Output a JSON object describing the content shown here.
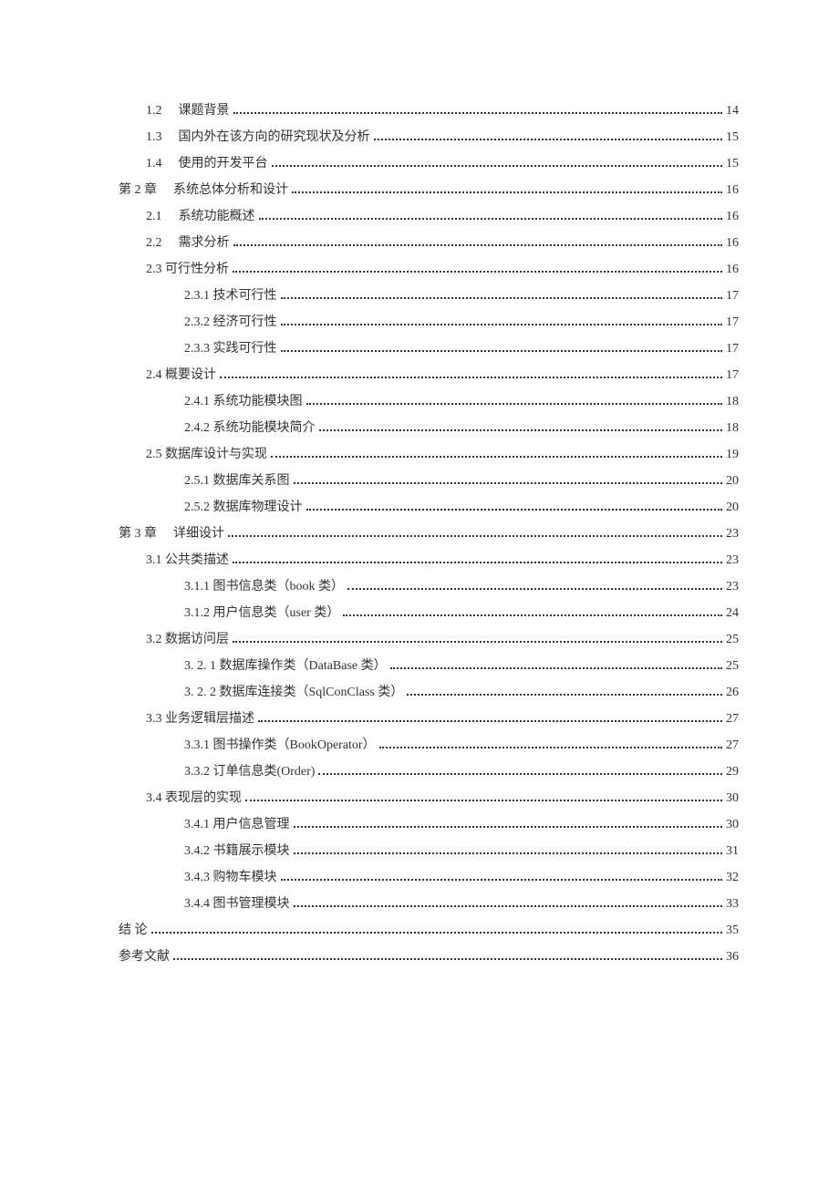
{
  "toc": [
    {
      "indent": "indent-num",
      "num": "1.2",
      "title": "课题背景",
      "page": "14"
    },
    {
      "indent": "indent-num",
      "num": "1.3",
      "title": "国内外在该方向的研究现状及分析",
      "page": "15"
    },
    {
      "indent": "indent-num",
      "num": "1.4",
      "title": "使用的开发平台",
      "page": "15"
    },
    {
      "indent": "indent-0",
      "num": "第 2 章",
      "title": "系统总体分析和设计",
      "page": "16"
    },
    {
      "indent": "indent-num",
      "num": "2.1",
      "title": "系统功能概述",
      "page": "16"
    },
    {
      "indent": "indent-num",
      "num": "2.2",
      "title": "需求分析",
      "page": "16"
    },
    {
      "indent": "indent-1",
      "num": "",
      "title": "2.3 可行性分析",
      "page": "16"
    },
    {
      "indent": "indent-2",
      "num": "",
      "title": "2.3.1 技术可行性",
      "page": "17"
    },
    {
      "indent": "indent-2",
      "num": "",
      "title": "2.3.2 经济可行性",
      "page": "17"
    },
    {
      "indent": "indent-2",
      "num": "",
      "title": "2.3.3 实践可行性",
      "page": "17"
    },
    {
      "indent": "indent-1",
      "num": "",
      "title": "2.4 概要设计",
      "page": "17"
    },
    {
      "indent": "indent-2",
      "num": "",
      "title": "2.4.1 系统功能模块图",
      "page": "18"
    },
    {
      "indent": "indent-2",
      "num": "",
      "title": "2.4.2 系统功能模块简介",
      "page": "18"
    },
    {
      "indent": "indent-1",
      "num": "",
      "title": "2.5 数据库设计与实现",
      "page": "19"
    },
    {
      "indent": "indent-2",
      "num": "",
      "title": "2.5.1 数据库关系图",
      "page": "20"
    },
    {
      "indent": "indent-2",
      "num": "",
      "title": "2.5.2 数据库物理设计",
      "page": "20"
    },
    {
      "indent": "indent-0",
      "num": "第 3 章",
      "title": "详细设计",
      "page": "23"
    },
    {
      "indent": "indent-1",
      "num": "",
      "title": "3.1 公共类描述",
      "page": "23"
    },
    {
      "indent": "indent-2",
      "num": "",
      "title": "3.1.1 图书信息类（book 类）",
      "page": "23"
    },
    {
      "indent": "indent-2",
      "num": "",
      "title": "3.1.2 用户信息类（user 类）",
      "page": "24"
    },
    {
      "indent": "indent-1",
      "num": "",
      "title": "3.2 数据访问层",
      "page": "25"
    },
    {
      "indent": "indent-2",
      "num": "",
      "title": "3. 2. 1 数据库操作类（DataBase 类）",
      "page": "25"
    },
    {
      "indent": "indent-2",
      "num": "",
      "title": "3. 2. 2 数据库连接类（SqlConClass 类）",
      "page": "26"
    },
    {
      "indent": "indent-1",
      "num": "",
      "title": "3.3 业务逻辑层描述",
      "page": "27"
    },
    {
      "indent": "indent-2",
      "num": "",
      "title": "3.3.1 图书操作类（BookOperator）",
      "page": "27"
    },
    {
      "indent": "indent-2",
      "num": "",
      "title": "3.3.2 订单信息类(Order)",
      "page": "29"
    },
    {
      "indent": "indent-1",
      "num": "",
      "title": "3.4 表现层的实现",
      "page": "30"
    },
    {
      "indent": "indent-2",
      "num": "",
      "title": "3.4.1 用户信息管理",
      "page": "30"
    },
    {
      "indent": "indent-2",
      "num": "",
      "title": "3.4.2 书籍展示模块",
      "page": "31"
    },
    {
      "indent": "indent-2",
      "num": "",
      "title": "3.4.3 购物车模块",
      "page": "32"
    },
    {
      "indent": "indent-2",
      "num": "",
      "title": "3.4.4 图书管理模块",
      "page": "33"
    },
    {
      "indent": "indent-0b",
      "num": "",
      "title": "结   论",
      "page": "35"
    },
    {
      "indent": "indent-0b",
      "num": "",
      "title": "参考文献",
      "page": "36"
    }
  ]
}
